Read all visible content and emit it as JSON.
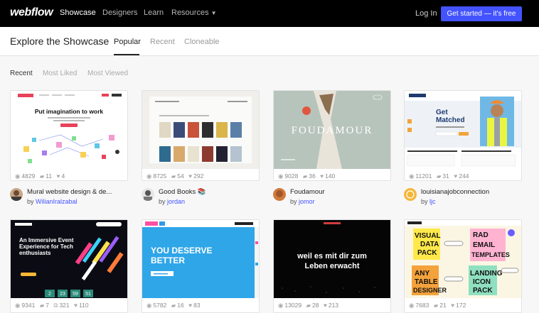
{
  "nav": {
    "logo": "webflow",
    "links": [
      "Showcase",
      "Designers",
      "Learn",
      "Resources"
    ],
    "login": "Log In",
    "cta": "Get started — it's free"
  },
  "subheader": {
    "title": "Explore the Showcase",
    "tabs": [
      "Popular",
      "Recent",
      "Cloneable"
    ]
  },
  "filters": [
    "Recent",
    "Most Liked",
    "Most Viewed"
  ],
  "cards": [
    {
      "views": "4829",
      "comments": "11",
      "likes": "4",
      "title": "Mural website design & de...",
      "by_prefix": "by",
      "author": "WilianIralzabal",
      "thumb": {
        "headline": "Put imagination to work"
      }
    },
    {
      "views": "8725",
      "comments": "54",
      "likes": "292",
      "title": "Good Books 📚",
      "by_prefix": "by",
      "author": "jordan"
    },
    {
      "views": "9028",
      "comments": "36",
      "likes": "140",
      "title": "Foudamour",
      "by_prefix": "by",
      "author": "jomor",
      "thumb": {
        "headline": "FOUDAMOUR"
      }
    },
    {
      "views": "11201",
      "comments": "31",
      "likes": "244",
      "title": "louisianajobconnection",
      "by_prefix": "by",
      "author": "ljc",
      "thumb": {
        "headline_1": "Get",
        "headline_2": "Matched"
      }
    },
    {
      "views": "9341",
      "comments": "7",
      "clones": "321",
      "likes": "110",
      "thumb": {
        "headline": "An Immersive Event Experience for Tech enthusiasts",
        "counters": [
          "2",
          "23",
          "59",
          "51"
        ]
      }
    },
    {
      "views": "5782",
      "comments": "16",
      "likes": "83",
      "thumb": {
        "headline_1": "YOU DESERVE",
        "headline_2": "BETTER"
      }
    },
    {
      "views": "13029",
      "comments": "28",
      "likes": "213",
      "thumb": {
        "headline_1": "weil es mit dir zum",
        "headline_2": "Leben erwacht"
      }
    },
    {
      "views": "7683",
      "comments": "21",
      "likes": "172",
      "thumb": {
        "words": [
          "VISUAL",
          "DATA",
          "PACK",
          "RAD",
          "EMAIL",
          "TEMPLATES",
          "ANY",
          "TABLE",
          "DESIGNER",
          "LANDING",
          "ICON",
          "PACK"
        ]
      }
    }
  ],
  "colors": {
    "cta": "#4353ff",
    "link": "#4353ff",
    "nav_bg": "#000000"
  }
}
